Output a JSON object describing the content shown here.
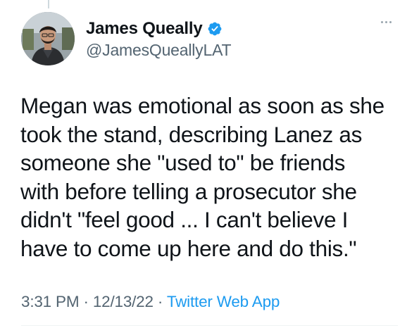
{
  "tweet": {
    "author": {
      "display_name": "James Queally",
      "handle": "@JamesQueallyLAT",
      "verified": true,
      "avatar_icon": "profile-photo",
      "verified_icon": "verified-badge-icon"
    },
    "text": "Megan was emotional as soon as she\ntook the stand, describing Lanez as\nsomeone she \"used to\" be friends\nwith before telling a prosecutor she\ndidn't \"feel good ... I can't believe I\nhave to come up here and do this.\"",
    "time": "3:31 PM",
    "date": "12/13/22",
    "separator": "·",
    "source": "Twitter Web App",
    "more_icon": "more-options-icon"
  },
  "colors": {
    "text_primary": "#0f1419",
    "text_secondary": "#536471",
    "link": "#1d9bf0",
    "verified": "#1d9bf0"
  }
}
